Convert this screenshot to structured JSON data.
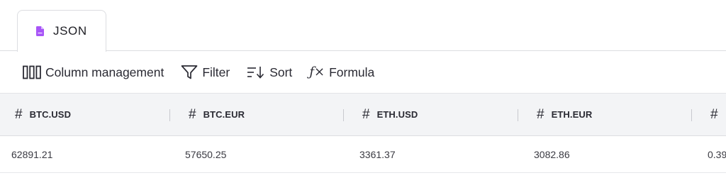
{
  "tab": {
    "label": "JSON",
    "icon": "json-file-icon",
    "icon_color": "#a855f7"
  },
  "toolbar": {
    "column_management": {
      "label": "Column management",
      "icon": "columns-icon"
    },
    "filter": {
      "label": "Filter",
      "icon": "filter-icon"
    },
    "sort": {
      "label": "Sort",
      "icon": "sort-icon"
    },
    "formula": {
      "label": "Formula",
      "icon": "fx-icon"
    }
  },
  "grid": {
    "hash_symbol": "#",
    "columns": [
      "BTC.USD",
      "BTC.EUR",
      "ETH.USD",
      "ETH.EUR",
      ""
    ],
    "rows": [
      [
        "62891.21",
        "57650.25",
        "3361.37",
        "3082.86",
        "0.39"
      ]
    ]
  },
  "colors": {
    "header_bg": "#f3f4f6",
    "border": "#dcdde1",
    "text": "#1e1e24"
  }
}
